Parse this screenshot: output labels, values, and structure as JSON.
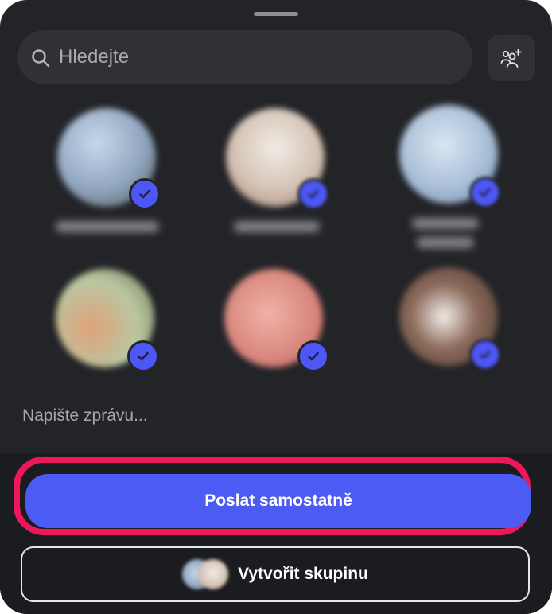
{
  "search": {
    "placeholder": "Hledejte",
    "icon": "search-icon"
  },
  "header": {
    "add_people_icon": "add-person-icon"
  },
  "contacts": [
    {
      "selected": true,
      "avatar_colors": [
        "#9fb7d6",
        "#5b6b4a"
      ],
      "name_blurred": true
    },
    {
      "selected": true,
      "avatar_colors": [
        "#e9e4dc",
        "#b89a88"
      ],
      "name_blurred": true
    },
    {
      "selected": true,
      "avatar_colors": [
        "#bcd0e6",
        "#8aa3c4"
      ],
      "name_blurred": true
    },
    {
      "selected": true,
      "avatar_colors": [
        "#cfe3ba",
        "#c08560"
      ],
      "name_blurred": true
    },
    {
      "selected": true,
      "avatar_colors": [
        "#e59c94",
        "#c86f6b"
      ],
      "name_blurred": true
    },
    {
      "selected": true,
      "avatar_colors": [
        "#8a6a5a",
        "#e4e0dc"
      ],
      "name_blurred": true
    }
  ],
  "message": {
    "placeholder": "Napište zprávu..."
  },
  "actions": {
    "send_separately_label": "Poslat samostatně",
    "create_group_label": "Vytvořit skupinu"
  },
  "colors": {
    "accent": "#4c5bf4",
    "highlight": "#f0165a",
    "sheet_background": "#232428"
  }
}
